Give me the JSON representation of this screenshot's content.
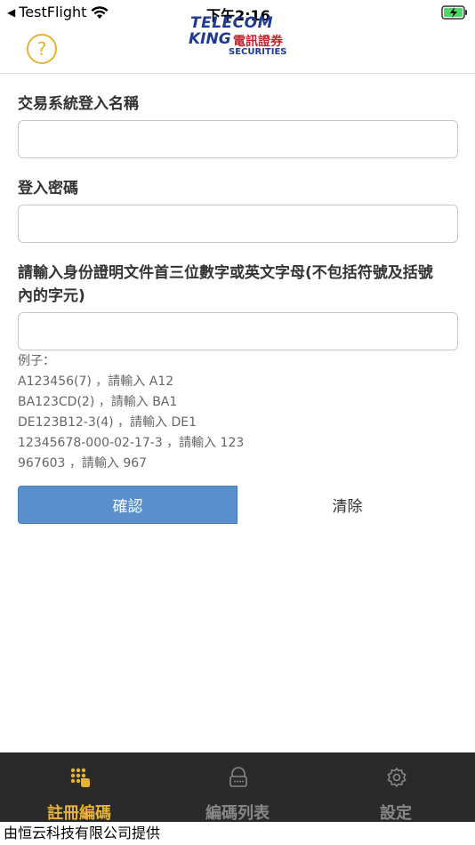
{
  "status_bar": {
    "back_label": "TestFlight",
    "time": "下午2:16"
  },
  "header": {
    "help_label": "?",
    "logo": {
      "line1": "TELECOM",
      "line2a": "KING",
      "line2b": "電訊證券",
      "line3": "SECURITIES"
    }
  },
  "form": {
    "username_label": "交易系統登入名稱",
    "username_value": "",
    "password_label": "登入密碼",
    "password_value": "",
    "id_label_line1": "請輸入身份證明文件首三位數字或英文字母(不包括符號及括號",
    "id_label_line2": "內的字元)",
    "id_value": "",
    "examples": [
      "例子：",
      "A123456(7) ，請輸入 A12",
      "BA123CD(2) ，請輸入 BA1",
      "DE123B12-3(4) ，請輸入 DE1",
      "12345678-000-02-17-3 ，請輸入 123",
      "967603 ，請輸入 967"
    ],
    "confirm_label": "確認",
    "clear_label": "清除"
  },
  "tabs": [
    {
      "label": "註冊編碼",
      "icon": "keypad-icon",
      "active": true
    },
    {
      "label": "編碼列表",
      "icon": "lock-icon",
      "active": false
    },
    {
      "label": "設定",
      "icon": "gear-icon",
      "active": false
    }
  ],
  "footer": {
    "text": "由恒云科技有限公司提供"
  },
  "colors": {
    "accent": "#e8b332",
    "confirm_button": "#5b8fcc",
    "tab_bar_bg": "#2a2a2a",
    "brand_blue": "#1f3a93",
    "brand_red": "#c0262d"
  }
}
